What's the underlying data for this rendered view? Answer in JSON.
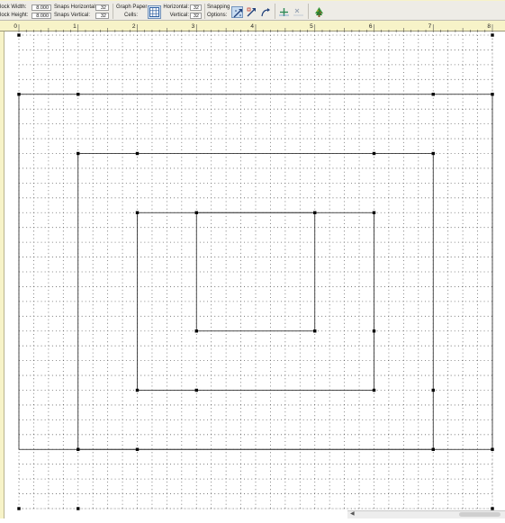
{
  "toolbar": {
    "block_width_label": "lock Width:",
    "block_width_value": "8.000",
    "block_height_label": "lock Height:",
    "block_height_value": "8.000",
    "snaps_horizontal_label": "Snaps Horizontal:",
    "snaps_horizontal_value": "32",
    "snaps_vertical_label": "Snaps Vertical:",
    "snaps_vertical_value": "32",
    "graph_paper_label_1": "Graph Paper",
    "graph_paper_label_2": "Cells:",
    "horizontal_label": "Horizontal:",
    "horizontal_value": "32",
    "vertical_label": "Vertical:",
    "vertical_value": "32",
    "snapping_label_1": "Snapping",
    "snapping_label_2": "Options:",
    "icons": [
      "graph-paper-icon",
      "snap-to-grid-icon",
      "snap-to-node-icon",
      "snap-to-drawing-icon",
      "add-node-icon",
      "delete-node-icon",
      "tree-icon"
    ]
  },
  "ruler": {
    "labels": [
      "0",
      "1",
      "2",
      "3",
      "4",
      "5",
      "6",
      "7",
      "8"
    ]
  },
  "grid": {
    "size_inches": 8,
    "snaps_per_inch": 4,
    "graph_paper_cells": 32
  },
  "drawing": {
    "squares_inches": [
      [
        0,
        1,
        8,
        7
      ],
      [
        1,
        2,
        7,
        7
      ],
      [
        2,
        3,
        6,
        6
      ],
      [
        3,
        3,
        5,
        5
      ]
    ],
    "nodes_inches": [
      [
        0,
        0
      ],
      [
        8,
        0
      ],
      [
        0,
        1
      ],
      [
        1,
        1
      ],
      [
        7,
        1
      ],
      [
        8,
        1
      ],
      [
        1,
        2
      ],
      [
        2,
        2
      ],
      [
        6,
        2
      ],
      [
        7,
        2
      ],
      [
        2,
        3
      ],
      [
        3,
        3
      ],
      [
        5,
        3
      ],
      [
        6,
        3
      ],
      [
        3,
        5
      ],
      [
        5,
        5
      ],
      [
        6,
        5
      ],
      [
        2,
        6
      ],
      [
        3,
        6
      ],
      [
        6,
        6
      ],
      [
        7,
        6
      ],
      [
        1,
        7
      ],
      [
        2,
        7
      ],
      [
        7,
        7
      ],
      [
        8,
        7
      ],
      [
        0,
        8
      ],
      [
        1,
        8
      ],
      [
        8,
        8
      ]
    ]
  }
}
